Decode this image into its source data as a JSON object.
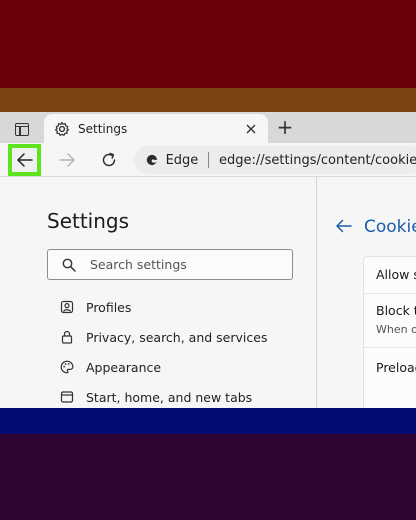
{
  "colors": {
    "band_top": "#6b000c",
    "band_orange": "#7a4310",
    "band_blue": "#040c74",
    "band_bottom": "#2e0430",
    "highlight": "#5ee41e",
    "link_blue": "#1b5fa8"
  },
  "tab": {
    "actions_icon": "tab-actions-icon",
    "icon": "gear-icon",
    "title": "Settings",
    "close_icon": "close-icon",
    "new_tab_label": "+"
  },
  "toolbar": {
    "back_icon": "arrow-left-icon",
    "forward_icon": "arrow-right-icon",
    "refresh_icon": "refresh-icon",
    "site_label": "Edge",
    "url": "edge://settings/content/cookies"
  },
  "settings": {
    "title": "Settings",
    "search_placeholder": "Search settings",
    "nav_items": [
      {
        "label": "Profiles",
        "icon": "profile-icon"
      },
      {
        "label": "Privacy, search, and services",
        "icon": "lock-icon"
      },
      {
        "label": "Appearance",
        "icon": "palette-icon"
      },
      {
        "label": "Start, home, and new tabs",
        "icon": "home-icon"
      }
    ]
  },
  "cookies_panel": {
    "title": "Cookie",
    "rows": [
      {
        "title": "Allow s",
        "subtitle": ""
      },
      {
        "title": "Block t",
        "subtitle": "When or"
      },
      {
        "title": "Preload",
        "subtitle": ""
      }
    ]
  }
}
